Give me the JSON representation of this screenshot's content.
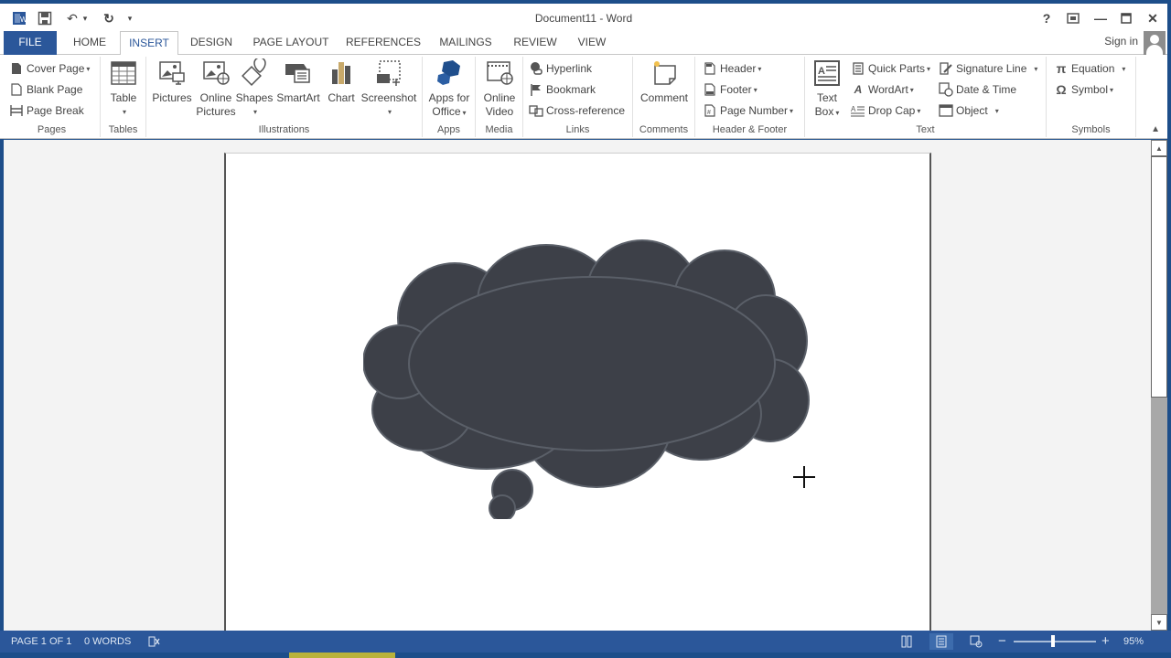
{
  "window": {
    "title": "Document11 - Word",
    "buttons": {
      "help": "?",
      "ribbon_display": "▭",
      "minimize": "—",
      "maximize": "☐",
      "close": "✕"
    }
  },
  "qat": {
    "word_icon": "W",
    "save_icon": "save-icon",
    "undo": "↶",
    "undo_dropdown": "▾",
    "redo": "↻",
    "customize": "▾"
  },
  "tabs": [
    {
      "label": "FILE"
    },
    {
      "label": "HOME"
    },
    {
      "label": "INSERT",
      "active": true
    },
    {
      "label": "DESIGN"
    },
    {
      "label": "PAGE LAYOUT"
    },
    {
      "label": "REFERENCES"
    },
    {
      "label": "MAILINGS"
    },
    {
      "label": "REVIEW"
    },
    {
      "label": "VIEW"
    }
  ],
  "account": {
    "sign_in": "Sign in"
  },
  "ribbon": {
    "groups": {
      "pages": {
        "label": "Pages",
        "cover_page": "Cover Page",
        "blank_page": "Blank Page",
        "page_break": "Page Break"
      },
      "tables": {
        "label": "Tables",
        "table": "Table"
      },
      "illustrations": {
        "label": "Illustrations",
        "pictures": "Pictures",
        "online_pictures_1": "Online",
        "online_pictures_2": "Pictures",
        "shapes": "Shapes",
        "smartart": "SmartArt",
        "chart": "Chart",
        "screenshot": "Screenshot"
      },
      "apps": {
        "label": "Apps",
        "apps_for_office_1": "Apps for",
        "apps_for_office_2": "Office"
      },
      "media": {
        "label": "Media",
        "online_video_1": "Online",
        "online_video_2": "Video"
      },
      "links": {
        "label": "Links",
        "hyperlink": "Hyperlink",
        "bookmark": "Bookmark",
        "cross_reference": "Cross-reference"
      },
      "comments": {
        "label": "Comments",
        "comment": "Comment"
      },
      "header_footer": {
        "label": "Header & Footer",
        "header": "Header",
        "footer": "Footer",
        "page_number": "Page Number"
      },
      "text": {
        "label": "Text",
        "text_box_1": "Text",
        "text_box_2": "Box",
        "quick_parts": "Quick Parts",
        "wordart": "WordArt",
        "drop_cap": "Drop Cap",
        "signature_line": "Signature Line",
        "date_time": "Date & Time",
        "object": "Object"
      },
      "symbols": {
        "label": "Symbols",
        "equation": "Equation",
        "symbol": "Symbol",
        "equation_glyph": "π",
        "symbol_glyph": "Ω"
      }
    }
  },
  "document": {
    "shape": "cloud-callout",
    "shape_fill": "#3d4048"
  },
  "status": {
    "page": "PAGE 1 OF 1",
    "words": "0 WORDS",
    "zoom_percent": "95%",
    "zoom_value": 95
  },
  "colors": {
    "accent": "#2b579a",
    "window_frame": "#1d4e8a"
  }
}
